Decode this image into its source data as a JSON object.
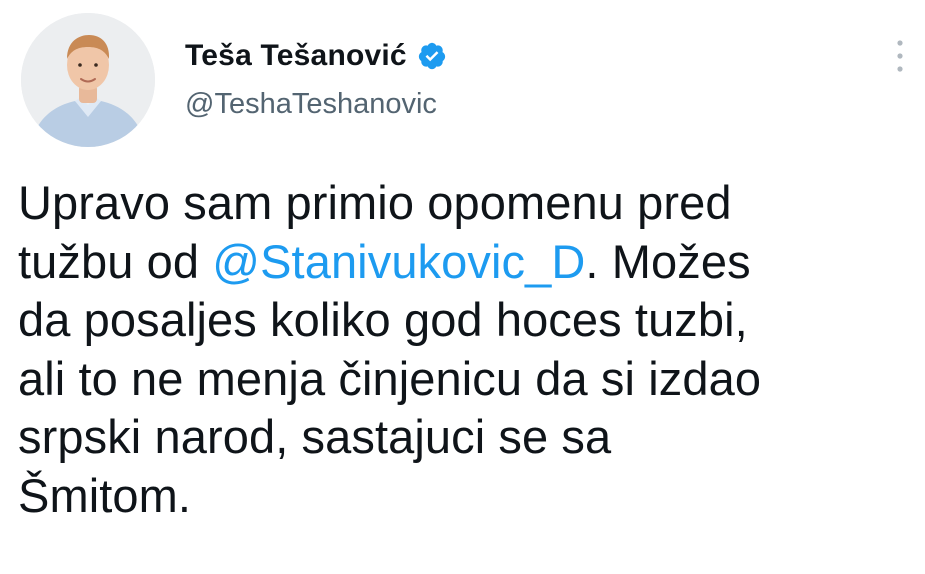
{
  "author": {
    "display_name": "Teša Tešanović",
    "handle": "@TeshaTeshanovic",
    "verified": true,
    "avatar_icon": "profile-photo",
    "verified_icon": "verified-badge-icon"
  },
  "menu": {
    "icon": "more-options-icon"
  },
  "tweet": {
    "lines": [
      {
        "segments": [
          {
            "text": "Upravo sam primio opomenu pred"
          }
        ]
      },
      {
        "segments": [
          {
            "text": "tužbu od "
          },
          {
            "text": "@Stanivukovic_D",
            "mention": true
          },
          {
            "text": ". Možes"
          }
        ]
      },
      {
        "segments": [
          {
            "text": "da posaljes koliko god hoces tuzbi,"
          }
        ]
      },
      {
        "segments": [
          {
            "text": "ali to ne menja činjenicu da si izdao"
          }
        ]
      },
      {
        "segments": [
          {
            "text": "srpski narod, sastajuci se sa"
          }
        ]
      },
      {
        "segments": [
          {
            "text": "Šmitom."
          }
        ]
      }
    ]
  },
  "colors": {
    "text": "#0f1419",
    "secondary": "#536471",
    "accent": "#1d9bf0"
  }
}
